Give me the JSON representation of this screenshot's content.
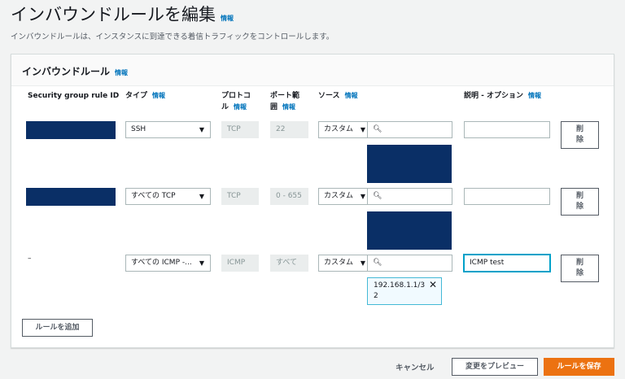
{
  "page": {
    "title": "インバウンドルールを編集",
    "info": "情報",
    "subtitle": "インバウンドルールは、インスタンスに到達できる着信トラフィックをコントロールします。"
  },
  "panel": {
    "title": "インバウンドルール",
    "info": "情報",
    "columns": {
      "id": "Security group rule ID",
      "type": "タイプ",
      "protocol_1": "プロトコ",
      "protocol_2": "ル",
      "port_1": "ポート範",
      "port_2": "囲",
      "source": "ソース",
      "desc": "説明 - オプション",
      "info": "情報"
    },
    "rows": [
      {
        "id": "",
        "type": "SSH",
        "protocol": "TCP",
        "port": "22",
        "source_type": "カスタム",
        "desc": "",
        "delete_1": "削",
        "delete_2": "除"
      },
      {
        "id": "",
        "type": "すべての TCP",
        "protocol": "TCP",
        "port": "0 - 655",
        "source_type": "カスタム",
        "desc": "",
        "delete_1": "削",
        "delete_2": "除"
      },
      {
        "id": "–",
        "type": "すべての ICMP -...",
        "protocol": "ICMP",
        "port": "すべて",
        "source_type": "カスタム",
        "desc": "ICMP test",
        "token_1": "192.168.1.1/3",
        "token_2": "2",
        "delete_1": "削",
        "delete_2": "除"
      }
    ],
    "add_rule": "ルールを追加"
  },
  "footer": {
    "cancel": "キャンセル",
    "preview": "変更をプレビュー",
    "save": "ルールを保存"
  },
  "colors": {
    "accent": "#ec7211",
    "link": "#0073bb",
    "redaction": "#0a2f66"
  }
}
